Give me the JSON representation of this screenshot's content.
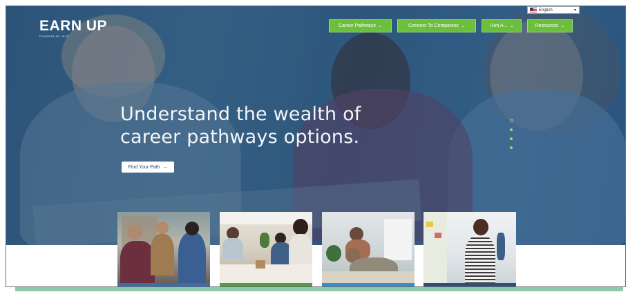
{
  "brand": {
    "name": "EARN UP",
    "sub": "POWERED BY JEVS"
  },
  "language": {
    "selected": "English",
    "flag": "us-flag-icon"
  },
  "nav": [
    {
      "label": "Career Pathways"
    },
    {
      "label": "Connect To Companies"
    },
    {
      "label": "I Am A..."
    },
    {
      "label": "Resources"
    }
  ],
  "hero": {
    "headline_line1": "Understand the wealth of",
    "headline_line2": "career pathways options.",
    "cta_label": "Find Your Path",
    "cta_icon": "arrow-right-icon"
  },
  "carousel": {
    "dot_count": 4,
    "active_index": 0
  },
  "cards": [
    {
      "name": "card-classroom",
      "stripe": "#3a6ea5"
    },
    {
      "name": "card-meeting",
      "stripe": "#4f9e4a"
    },
    {
      "name": "card-family",
      "stripe": "#3a8ec8"
    },
    {
      "name": "card-office",
      "stripe": "#2d4f7c"
    }
  ],
  "colors": {
    "accent": "#6cbf3c",
    "hero_overlay": "#2e5b84",
    "frame_shadow": "#8fc9ad"
  }
}
